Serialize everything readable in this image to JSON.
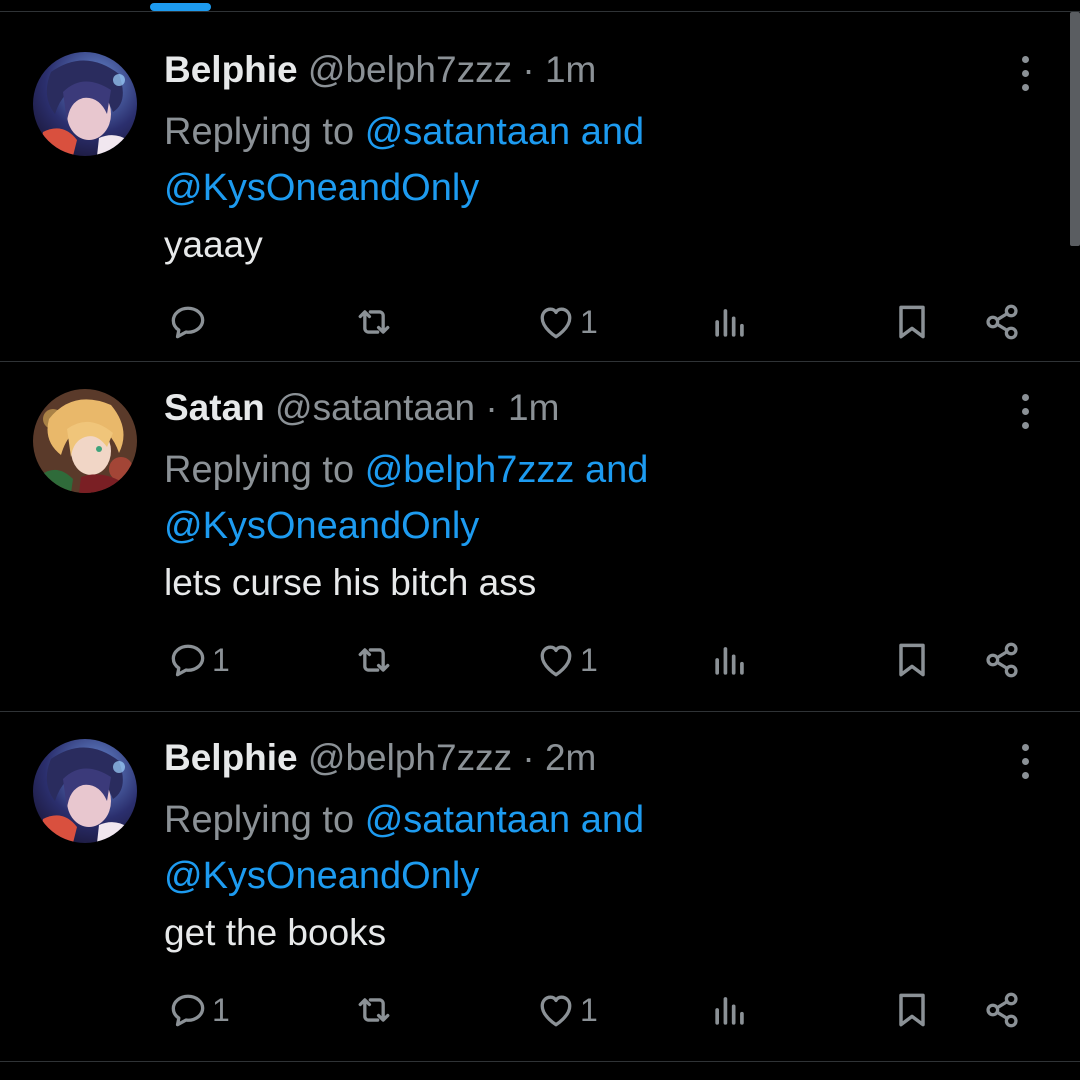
{
  "colors": {
    "background": "#000000",
    "accent": "#1d9bf0",
    "muted": "#8b9196",
    "text": "#e7e9ea",
    "divider": "#2f3336"
  },
  "tweets": [
    {
      "name": "Belphie",
      "handle": "@belph7zzz",
      "separator": "·",
      "time": "1m",
      "replying_prefix": "Replying to",
      "mention_1": "@satantaan",
      "and": "and",
      "mention_2": "@KysOneandOnly",
      "text": "yaaay",
      "reply_count": "",
      "retweet_count": "",
      "like_count": "1"
    },
    {
      "name": "Satan",
      "handle": "@satantaan",
      "separator": "·",
      "time": "1m",
      "replying_prefix": "Replying to",
      "mention_1": "@belph7zzz",
      "and": "and",
      "mention_2": "@KysOneandOnly",
      "text": "lets curse his bitch ass",
      "reply_count": "1",
      "retweet_count": "",
      "like_count": "1"
    },
    {
      "name": "Belphie",
      "handle": "@belph7zzz",
      "separator": "·",
      "time": "2m",
      "replying_prefix": "Replying to",
      "mention_1": "@satantaan",
      "and": "and",
      "mention_2": "@KysOneandOnly",
      "text": "get the books",
      "reply_count": "1",
      "retweet_count": "",
      "like_count": "1"
    }
  ],
  "icons": [
    "reply-icon",
    "retweet-icon",
    "like-icon",
    "views-icon",
    "bookmark-icon",
    "share-icon",
    "more-icon"
  ]
}
